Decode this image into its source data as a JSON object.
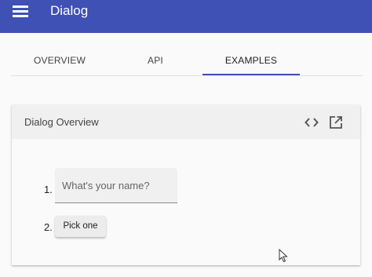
{
  "toolbar": {
    "title": "Dialog",
    "menu_icon": "menu-icon"
  },
  "tabs": [
    {
      "label": "OVERVIEW",
      "active": false
    },
    {
      "label": "API",
      "active": false
    },
    {
      "label": "EXAMPLES",
      "active": true
    }
  ],
  "card": {
    "title": "Dialog Overview",
    "icons": [
      "code-icon",
      "open-in-new-icon"
    ]
  },
  "example": {
    "items": [
      {
        "number": "1.",
        "placeholder": "What's your name?"
      },
      {
        "number": "2.",
        "button_label": "Pick one"
      }
    ]
  },
  "colors": {
    "primary": "#3f51b5",
    "background": "#fafafa",
    "card_header": "#f0f0f0"
  }
}
